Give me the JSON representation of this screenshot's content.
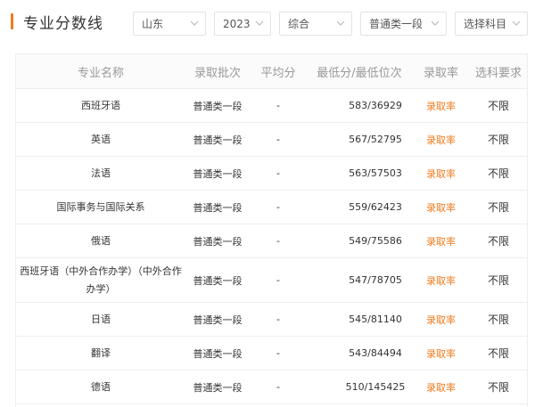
{
  "header": {
    "title": "专业分数线",
    "filters": {
      "province": "山东",
      "year": "2023",
      "type": "综合",
      "batch": "普通类一段",
      "subject": "选择科目"
    }
  },
  "table": {
    "columns": [
      "专业名称",
      "录取批次",
      "平均分",
      "最低分/最低位次",
      "录取率",
      "选科要求"
    ],
    "rows": [
      {
        "name": "西班牙语",
        "batch": "普通类一段",
        "avg": "-",
        "min": "583/36929",
        "rate": "录取率",
        "req": "不限"
      },
      {
        "name": "英语",
        "batch": "普通类一段",
        "avg": "-",
        "min": "567/52795",
        "rate": "录取率",
        "req": "不限"
      },
      {
        "name": "法语",
        "batch": "普通类一段",
        "avg": "-",
        "min": "563/57503",
        "rate": "录取率",
        "req": "不限"
      },
      {
        "name": "国际事务与国际关系",
        "batch": "普通类一段",
        "avg": "-",
        "min": "559/62423",
        "rate": "录取率",
        "req": "不限"
      },
      {
        "name": "俄语",
        "batch": "普通类一段",
        "avg": "-",
        "min": "549/75586",
        "rate": "录取率",
        "req": "不限"
      },
      {
        "name": "西班牙语（中外合作办学）（中外合作办学）",
        "batch": "普通类一段",
        "avg": "-",
        "min": "547/78705",
        "rate": "录取率",
        "req": "不限"
      },
      {
        "name": "日语",
        "batch": "普通类一段",
        "avg": "-",
        "min": "545/81140",
        "rate": "录取率",
        "req": "不限"
      },
      {
        "name": "翻译",
        "batch": "普通类一段",
        "avg": "-",
        "min": "543/84494",
        "rate": "录取率",
        "req": "不限"
      },
      {
        "name": "德语",
        "batch": "普通类一段",
        "avg": "-",
        "min": "510/145425",
        "rate": "录取率",
        "req": "不限"
      }
    ]
  },
  "colors": {
    "accent": "#f07b1d",
    "header_text": "#999999",
    "border": "#eeeeee"
  },
  "icons": {
    "dropdown": "chevron-down-icon"
  }
}
